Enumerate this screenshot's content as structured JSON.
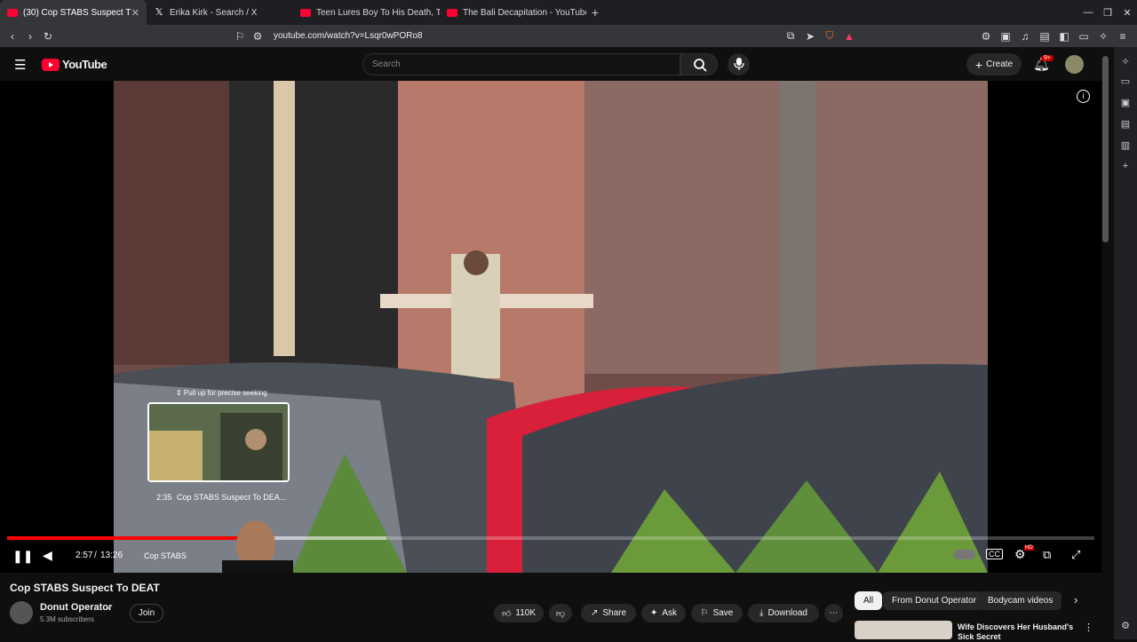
{
  "tabs": [
    {
      "label": "(30) Cop STABS Suspect T",
      "favicon": "youtube-icon",
      "active": true
    },
    {
      "label": "Erika Kirk - Search / X",
      "favicon": "x-icon",
      "active": false
    },
    {
      "label": "Teen Lures Boy To His Death, Th",
      "favicon": "youtube-icon",
      "active": false
    },
    {
      "label": "The Bali Decapitation - YouTube",
      "favicon": "youtube-icon",
      "active": false
    }
  ],
  "address": {
    "url": "youtube.com/watch?v=Lsqr0wPORo8"
  },
  "header": {
    "logo": "YouTube",
    "search_placeholder": "Search",
    "create_label": "Create",
    "notif_badge": "9+"
  },
  "player": {
    "preview_hint": "⇕ Pull up for precise seeking",
    "preview_time": "2:35",
    "preview_title": "Cop STABS Suspect To DEA...",
    "time_current": "2:57",
    "time_sep": "/",
    "time_total": "13:26",
    "chapter": "Cop STABS",
    "progress_fraction": 0.22,
    "hd_badge": "HD"
  },
  "video": {
    "title": "Cop STABS Suspect To DEAT",
    "channel": "Donut Operator",
    "subscribers": "5.3M subscribers",
    "join_label": "Join",
    "likes": "110K",
    "share_label": "Share",
    "ask_label": "Ask",
    "save_label": "Save",
    "download_label": "Download"
  },
  "related": {
    "chips": [
      "All",
      "From Donut Operator",
      "Bodycam videos"
    ],
    "first_title": "Wife Discovers Her Husband's Sick Secret"
  },
  "colors": {
    "accent": "#ff0033",
    "background": "#0f0f0f"
  }
}
